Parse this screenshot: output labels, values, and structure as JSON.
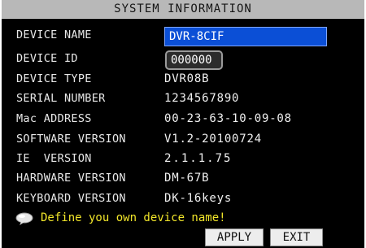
{
  "window": {
    "title": "SYSTEM INFORMATION"
  },
  "rows": [
    {
      "label": "DEVICE NAME",
      "value": "DVR-8CIF"
    },
    {
      "label": "DEVICE ID",
      "value": "000000"
    },
    {
      "label": "DEVICE TYPE",
      "value": "DVR08B"
    },
    {
      "label": "SERIAL NUMBER",
      "value": "1234567890"
    },
    {
      "label": "Mac ADDRESS",
      "value": "00-23-63-10-09-08"
    },
    {
      "label": "SOFTWARE VERSION",
      "value": "V1.2-20100724"
    },
    {
      "label": "IE  VERSION",
      "value": "2.1.1.75"
    },
    {
      "label": "HARDWARE VERSION",
      "value": "DM-67B"
    },
    {
      "label": "KEYBOARD VERSION",
      "value": "DK-16keys"
    }
  ],
  "hint": {
    "icon": "speech-bubble-icon",
    "text": "Define you own device name!"
  },
  "buttons": {
    "apply": "APPLY",
    "exit": "EXIT"
  },
  "colors": {
    "background": "#000000",
    "title_bar": "#b8b8b8",
    "active_field": "#0b4fd6",
    "hint_text": "#f2e62a"
  }
}
